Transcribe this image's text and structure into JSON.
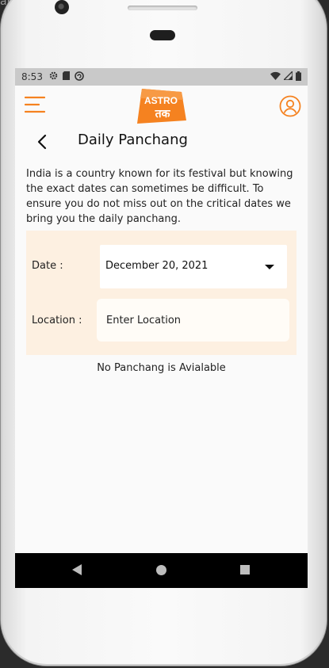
{
  "statusbar": {
    "time": "8:53"
  },
  "appbar": {
    "logo_text_top": "ASTRO",
    "logo_text_bottom": "तक"
  },
  "page": {
    "title": "Daily Panchang",
    "description": "India is a country known for its festival but knowing the exact dates can sometimes be difficult. To ensure you do not miss out on the critical dates we bring you the daily panchang."
  },
  "form": {
    "date_label": "Date :",
    "date_value": "December 20, 2021",
    "location_label": "Location :",
    "location_placeholder": "Enter Location"
  },
  "empty_message": "No Panchang is Avialable",
  "colors": {
    "accent": "#f58220",
    "form_bg": "#fdf0e1"
  },
  "icons": [
    "camera-icon",
    "settings-icon",
    "sd-card-icon",
    "sync-icon",
    "wifi-icon",
    "signal-icon",
    "battery-icon",
    "menu-icon",
    "profile-icon",
    "back-arrow-icon",
    "dropdown-caret-icon",
    "nav-back-icon",
    "nav-home-icon",
    "nav-recents-icon"
  ]
}
